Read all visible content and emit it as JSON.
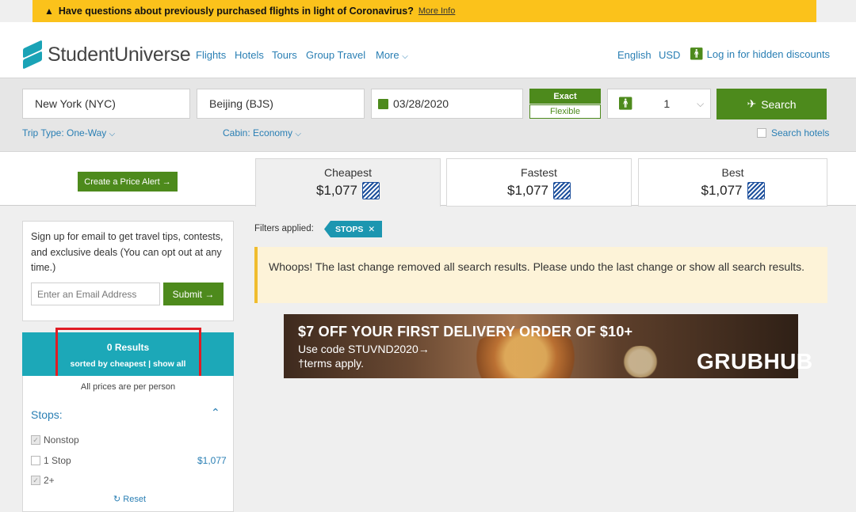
{
  "alert": {
    "icon": "warning-icon",
    "text": "Have questions about previously purchased flights in light of Coronavirus?",
    "link": "More Info"
  },
  "header": {
    "brand": "StudentUniverse",
    "nav": [
      "Flights",
      "Hotels",
      "Tours",
      "Group Travel",
      "More"
    ],
    "language": "English",
    "currency": "USD",
    "login": "Log in for hidden discounts"
  },
  "search": {
    "origin": "New York (NYC)",
    "destination": "Beijing (BJS)",
    "date": "03/28/2020",
    "date_mode_exact": "Exact",
    "date_mode_flexible": "Flexible",
    "passengers": "1",
    "search_button": "Search",
    "trip_type_label": "Trip Type:",
    "trip_type_value": "One-Way",
    "cabin_label": "Cabin:",
    "cabin_value": "Economy",
    "search_hotels": "Search hotels"
  },
  "price_alert": {
    "label": "Create a Price Alert"
  },
  "sort_tabs": [
    {
      "label": "Cheapest",
      "price": "$1,077",
      "active": true
    },
    {
      "label": "Fastest",
      "price": "$1,077",
      "active": false
    },
    {
      "label": "Best",
      "price": "$1,077",
      "active": false
    }
  ],
  "email_signup": {
    "text": "Sign up for email to get travel tips, contests, and exclusive deals (You can opt out at any time.)",
    "placeholder": "Enter an Email Address",
    "submit": "Submit"
  },
  "results": {
    "count": "0 Results",
    "sort_line": "sorted by cheapest | show all",
    "per_person": "All prices are per person"
  },
  "stops_filter": {
    "title": "Stops:",
    "options": [
      {
        "label": "Nonstop",
        "checked": true
      },
      {
        "label": "1 Stop",
        "checked": false,
        "price": "$1,077"
      },
      {
        "label": "2+",
        "checked": true
      }
    ],
    "reset": "Reset"
  },
  "filters_applied": {
    "label": "Filters applied:",
    "chip": "STOPS"
  },
  "message": "Whoops! The last change removed all search results. Please undo the last change or show all search results.",
  "ad": {
    "headline": "$7 OFF YOUR FIRST DELIVERY ORDER OF $10+",
    "code_line": "Use code STUVND2020→",
    "terms": "†terms apply.",
    "brand": "GRUBHUB"
  },
  "colors": {
    "alert_bg": "#fbc21b",
    "brand_teal": "#1aa3b6",
    "primary_green": "#4d8a1c",
    "link_blue": "#2a7fb4",
    "results_teal": "#1ca8b8",
    "highlight_red": "#e01c24",
    "notice_bg": "#fdf3d8"
  }
}
